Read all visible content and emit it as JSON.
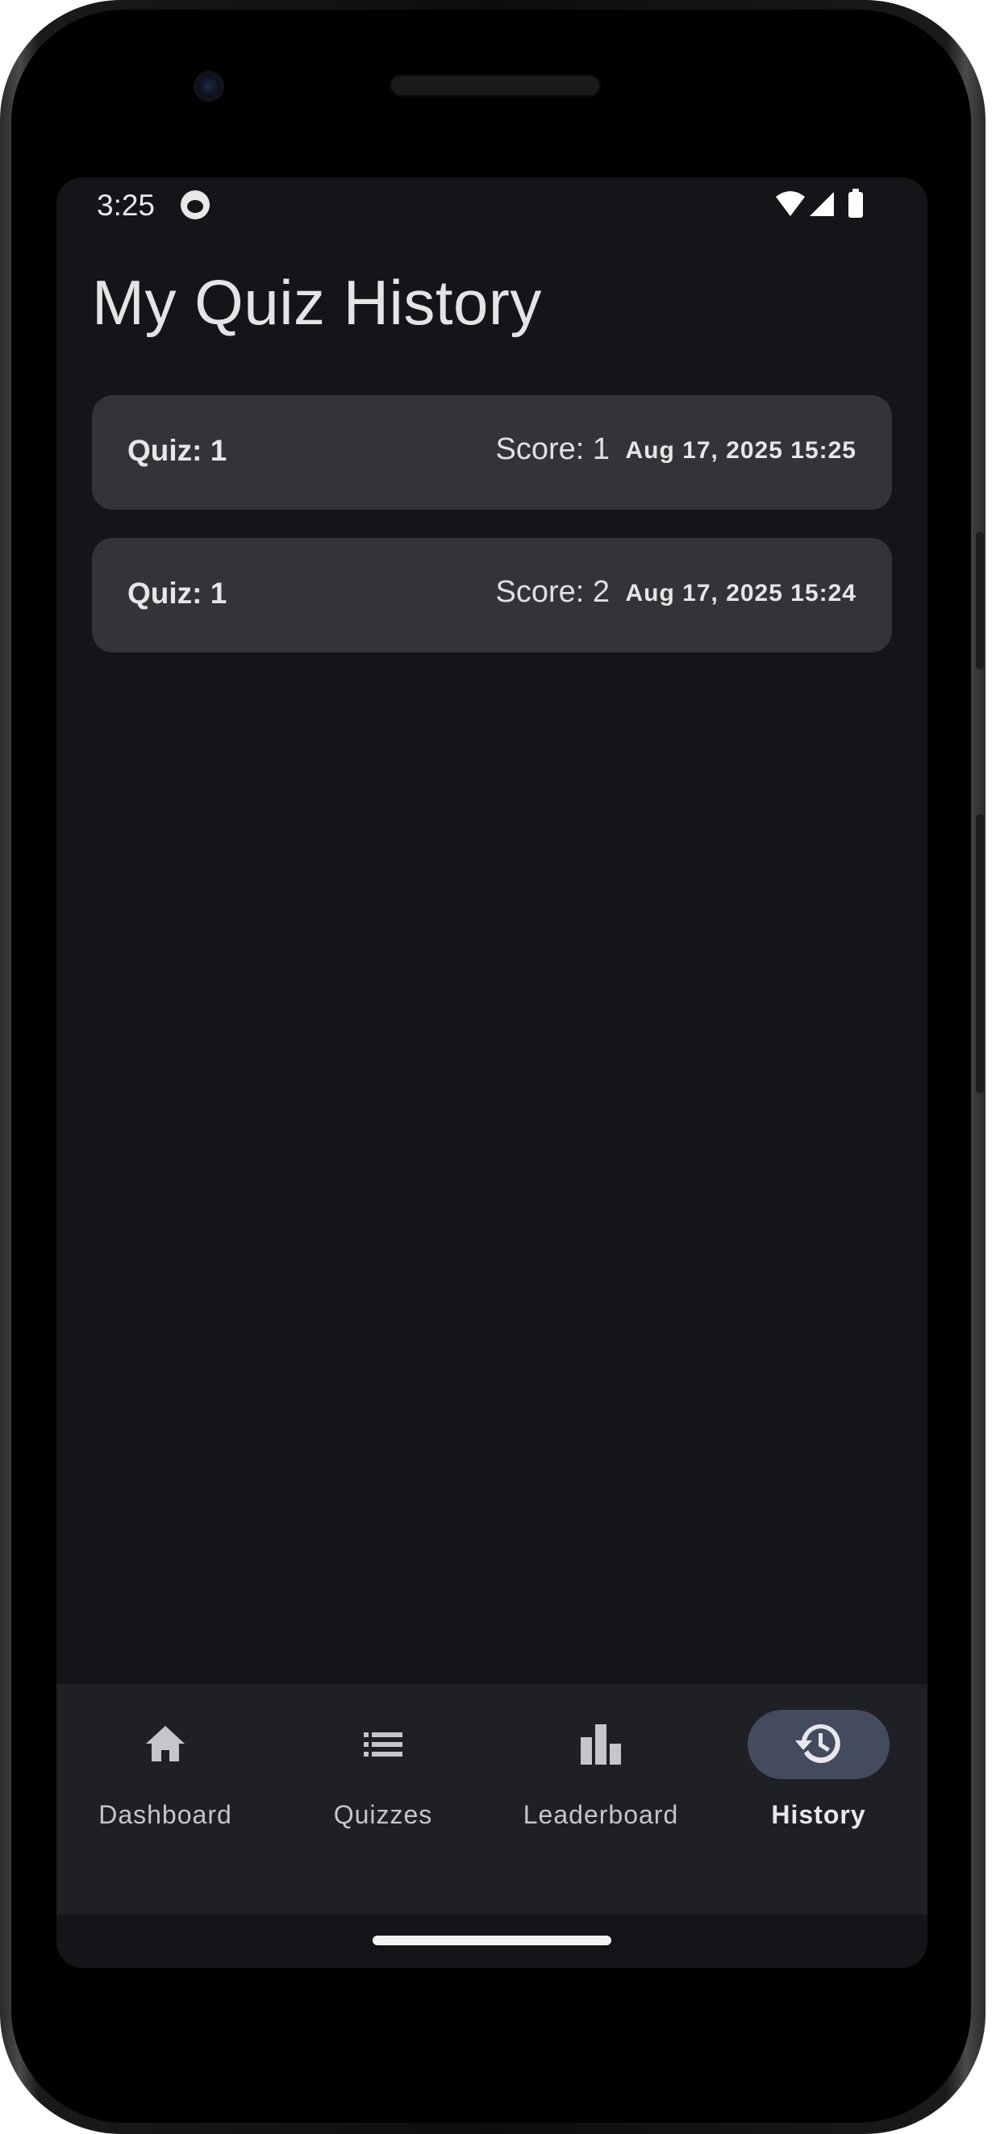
{
  "status_bar": {
    "time": "3:25"
  },
  "page": {
    "title": "My Quiz History"
  },
  "history": [
    {
      "quiz": "Quiz: 1",
      "score": "Score: 1",
      "date": "Aug 17, 2025 15:25"
    },
    {
      "quiz": "Quiz: 1",
      "score": "Score: 2",
      "date": "Aug 17, 2025 15:24"
    }
  ],
  "bottom_nav": {
    "items": [
      {
        "label": "Dashboard",
        "icon": "home-icon",
        "active": false
      },
      {
        "label": "Quizzes",
        "icon": "list-icon",
        "active": false
      },
      {
        "label": "Leaderboard",
        "icon": "bar-chart-icon",
        "active": false
      },
      {
        "label": "History",
        "icon": "history-icon",
        "active": true
      }
    ]
  },
  "colors": {
    "background": "#141518",
    "card": "#333438",
    "nav_background": "#1f2024",
    "active_pill": "#434b5f"
  }
}
